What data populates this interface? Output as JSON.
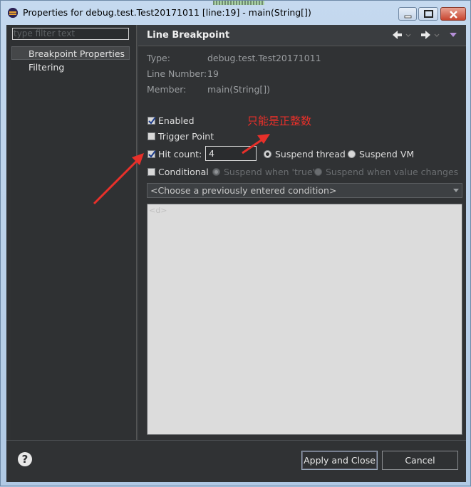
{
  "window": {
    "title": "Properties for debug.test.Test20171011 [line:19] - main(String[])"
  },
  "sidebar": {
    "filter_placeholder": "type filter text",
    "items": [
      {
        "label": "Breakpoint Properties",
        "selected": true
      },
      {
        "label": "Filtering",
        "selected": false
      }
    ]
  },
  "page": {
    "title": "Line Breakpoint",
    "type_label": "Type:",
    "type_value": "debug.test.Test20171011",
    "line_label": "Line Number:",
    "line_value": "19",
    "member_label": "Member:",
    "member_value": "main(String[])",
    "enabled_label": "Enabled",
    "enabled_checked": true,
    "trigger_label": "Trigger Point",
    "trigger_checked": false,
    "hitcount_label": "Hit count:",
    "hitcount_checked": true,
    "hitcount_value": "4",
    "suspend_thread_label": "Suspend thread",
    "suspend_vm_label": "Suspend VM",
    "suspend_selected": "thread",
    "conditional_label": "Conditional",
    "conditional_checked": false,
    "when_true_label": "Suspend when 'true'",
    "when_changes_label": "Suspend when value changes",
    "condition_combo_value": "<Choose a previously entered condition>",
    "editor_hint": "<d>"
  },
  "annotation": {
    "text": "只能是正整数",
    "color": "#e8302a"
  },
  "footer": {
    "help_glyph": "?",
    "apply_close_label": "Apply and Close",
    "cancel_label": "Cancel"
  }
}
